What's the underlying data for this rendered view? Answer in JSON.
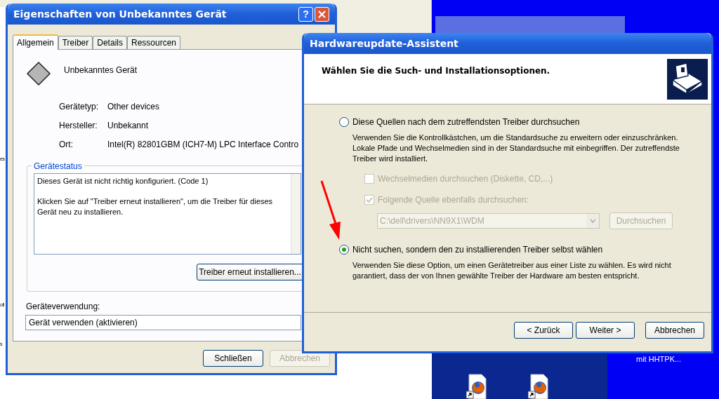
{
  "desktop": {
    "edge_texts": [
      "es",
      "oll",
      "s"
    ],
    "icon_caption": "mit HHTPK..."
  },
  "properties_window": {
    "title": "Eigenschaften von Unbekanntes Gerät",
    "help_button": "?",
    "tabs": [
      {
        "label": "Allgemein",
        "selected": true
      },
      {
        "label": "Treiber",
        "selected": false
      },
      {
        "label": "Details",
        "selected": false
      },
      {
        "label": "Ressourcen",
        "selected": false
      }
    ],
    "device_name": "Unbekanntes Gerät",
    "fields": [
      {
        "label": "Gerätetyp:",
        "value": "Other devices"
      },
      {
        "label": "Hersteller:",
        "value": "Unbekannt"
      },
      {
        "label": "Ort:",
        "value": "Intel(R) 82801GBM (ICH7-M) LPC Interface Contro"
      }
    ],
    "status_group": {
      "title": "Gerätestatus",
      "lines": [
        "Dieses Gerät ist nicht richtig konfiguriert. (Code 1)",
        "Klicken Sie auf \"Treiber erneut installieren\", um die Treiber für dieses Gerät neu zu installieren."
      ],
      "button": "Treiber erneut installieren..."
    },
    "usage": {
      "label": "Geräteverwendung:",
      "value": "Gerät verwenden (aktivieren)"
    },
    "buttons": [
      {
        "label": "Schließen",
        "disabled": false
      },
      {
        "label": "Abbrechen",
        "disabled": true
      }
    ]
  },
  "wizard": {
    "title": "Hardwareupdate-Assistent",
    "heading": "Wählen Sie die Such- und Installationsoptionen.",
    "options": [
      {
        "label": "Diese Quellen nach dem zutreffendsten Treiber durchsuchen",
        "selected": false,
        "description": "Verwenden Sie die Kontrollkästchen, um die Standardsuche zu erweitern oder einzuschränken. Lokale Pfade und Wechselmedien sind in der Standardsuche mit einbegriffen. Der zutreffendste Treiber wird installiert.",
        "checkboxes": [
          {
            "label": "Wechselmedien durchsuchen (Diskette, CD,...)",
            "checked": false,
            "disabled": true
          },
          {
            "label": "Folgende Quelle ebenfalls durchsuchen:",
            "checked": true,
            "disabled": true
          }
        ],
        "path_field": {
          "value": "C:\\dell\\drivers\\NN9X1\\WDM",
          "disabled": true
        },
        "browse_button": {
          "label": "Durchsuchen",
          "disabled": true
        }
      },
      {
        "label": "Nicht suchen, sondern den zu installierenden Treiber selbst wählen",
        "selected": true,
        "description": "Verwenden Sie diese Option, um einen Gerätetreiber aus einer Liste zu wählen. Es wird nicht garantiert, dass der von Ihnen gewählte Treiber der Hardware am besten entspricht."
      }
    ],
    "buttons": [
      {
        "label": "< Zurück"
      },
      {
        "label": "Weiter >"
      },
      {
        "label": "Abbrechen"
      }
    ]
  }
}
